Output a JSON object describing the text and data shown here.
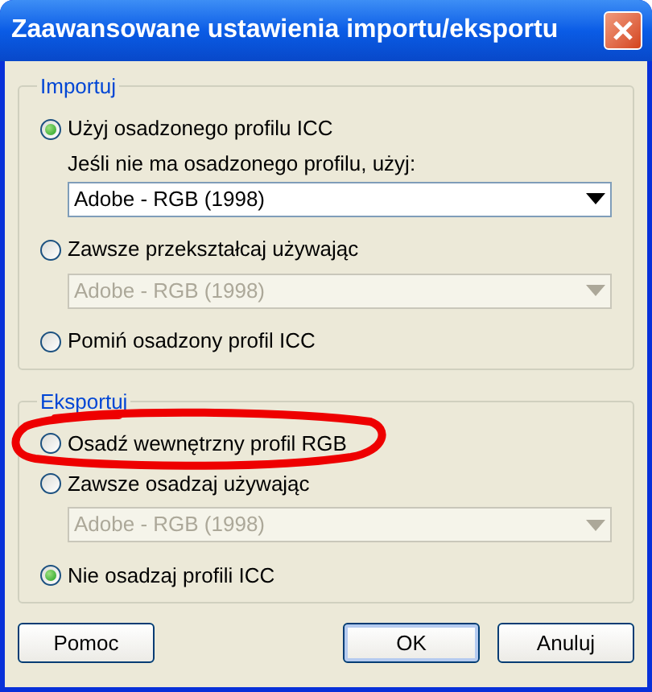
{
  "window": {
    "title": "Zaawansowane ustawienia importu/eksportu"
  },
  "groups": [
    {
      "legend": "Importuj",
      "items": [
        {
          "kind": "radio",
          "label": "Użyj osadzonego profilu ICC",
          "selected": true,
          "highlighted": false
        },
        {
          "kind": "note",
          "text": "Jeśli nie ma osadzonego profilu, użyj:"
        },
        {
          "kind": "dropdown",
          "value": "Adobe - RGB (1998)",
          "disabled": false
        },
        {
          "kind": "radio",
          "label": "Zawsze przekształcaj używając",
          "selected": false,
          "highlighted": false
        },
        {
          "kind": "dropdown",
          "value": "Adobe - RGB (1998)",
          "disabled": true
        },
        {
          "kind": "radio",
          "label": "Pomiń osadzony profil ICC",
          "selected": false,
          "highlighted": false
        }
      ]
    },
    {
      "legend": "Eksportuj",
      "items": [
        {
          "kind": "radio",
          "label": "Osadź wewnętrzny profil RGB",
          "selected": false,
          "highlighted": true
        },
        {
          "kind": "radio",
          "label": "Zawsze osadzaj używając",
          "selected": false,
          "highlighted": false
        },
        {
          "kind": "dropdown",
          "value": "Adobe - RGB (1998)",
          "disabled": true
        },
        {
          "kind": "radio",
          "label": "Nie osadzaj profili ICC",
          "selected": true,
          "highlighted": false
        }
      ]
    }
  ],
  "buttons": [
    {
      "label": "Pomoc",
      "default": false
    },
    {
      "label": "OK",
      "default": true
    },
    {
      "label": "Anuluj",
      "default": false
    }
  ]
}
